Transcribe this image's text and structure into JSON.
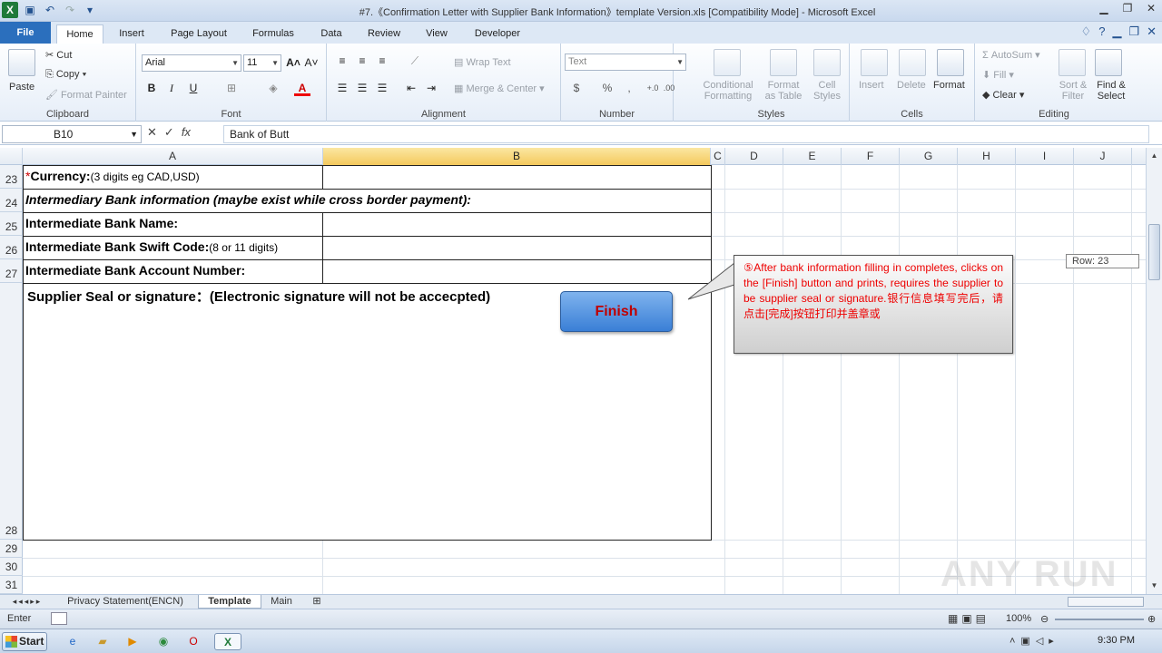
{
  "window": {
    "title": "#7.《Confirmation Letter with Supplier Bank Information》template Version.xls  [Compatibility Mode]  -  Microsoft Excel"
  },
  "ribbon_tabs": [
    "File",
    "Home",
    "Insert",
    "Page Layout",
    "Formulas",
    "Data",
    "Review",
    "View",
    "Developer"
  ],
  "ribbon": {
    "clipboard": {
      "label": "Clipboard",
      "paste": "Paste",
      "cut": "Cut",
      "copy": "Copy",
      "format_painter": "Format Painter"
    },
    "font": {
      "label": "Font",
      "family": "Arial",
      "size": "11"
    },
    "alignment": {
      "label": "Alignment",
      "wrap_text": "Wrap Text",
      "merge_center": "Merge & Center"
    },
    "number": {
      "label": "Number",
      "format": "Text",
      "currency": "$",
      "percent": "%",
      "comma": ","
    },
    "styles": {
      "label": "Styles",
      "conditional": "Conditional",
      "conditional2": "Formatting",
      "format_as": "Format",
      "format_as2": "as Table",
      "cell": "Cell",
      "cell2": "Styles"
    },
    "cells": {
      "label": "Cells",
      "insert": "Insert",
      "delete": "Delete",
      "format": "Format"
    },
    "editing": {
      "label": "Editing",
      "autosum": "AutoSum",
      "fill": "Fill",
      "clear": "Clear",
      "sort": "Sort &",
      "sort2": "Filter",
      "find": "Find &",
      "find2": "Select"
    }
  },
  "formula_bar": {
    "name_box": "B10",
    "fx": "fx",
    "value": "Bank of Butt"
  },
  "columns": [
    "A",
    "B",
    "C",
    "D",
    "E",
    "F",
    "G",
    "H",
    "I",
    "J"
  ],
  "rows": [
    "23",
    "24",
    "25",
    "26",
    "27",
    "28",
    "29",
    "30",
    "31"
  ],
  "cells": {
    "r23_req": "*",
    "r23_bold": "Currency:",
    "r23_small": "(3 digits eg CAD,USD)",
    "r24": "Intermediary Bank information (maybe exist while cross border payment):",
    "r25": "Intermediate Bank Name:",
    "r26_bold": "Intermediate Bank Swift Code:",
    "r26_small": "(8 or 11 digits)",
    "r27": "Intermediate Bank Account Number:",
    "r28": "Supplier Seal or signature：(Electronic signature will not be accecpted)"
  },
  "finish_button": "Finish",
  "callout": "⑤After bank information filling in completes, clicks on the [Finish] button and prints, requires the supplier to be supplier seal or signature.银行信息填写完后，请点击[完成]按钮打印并盖章或",
  "row_tip": "Row: 23",
  "sheet_tabs": [
    "Privacy Statement(ENCN)",
    "Template",
    "Main"
  ],
  "status": {
    "mode": "Enter",
    "zoom": "100%"
  },
  "taskbar": {
    "start": "Start",
    "time": "9:30 PM"
  },
  "watermark": "ANY RUN"
}
